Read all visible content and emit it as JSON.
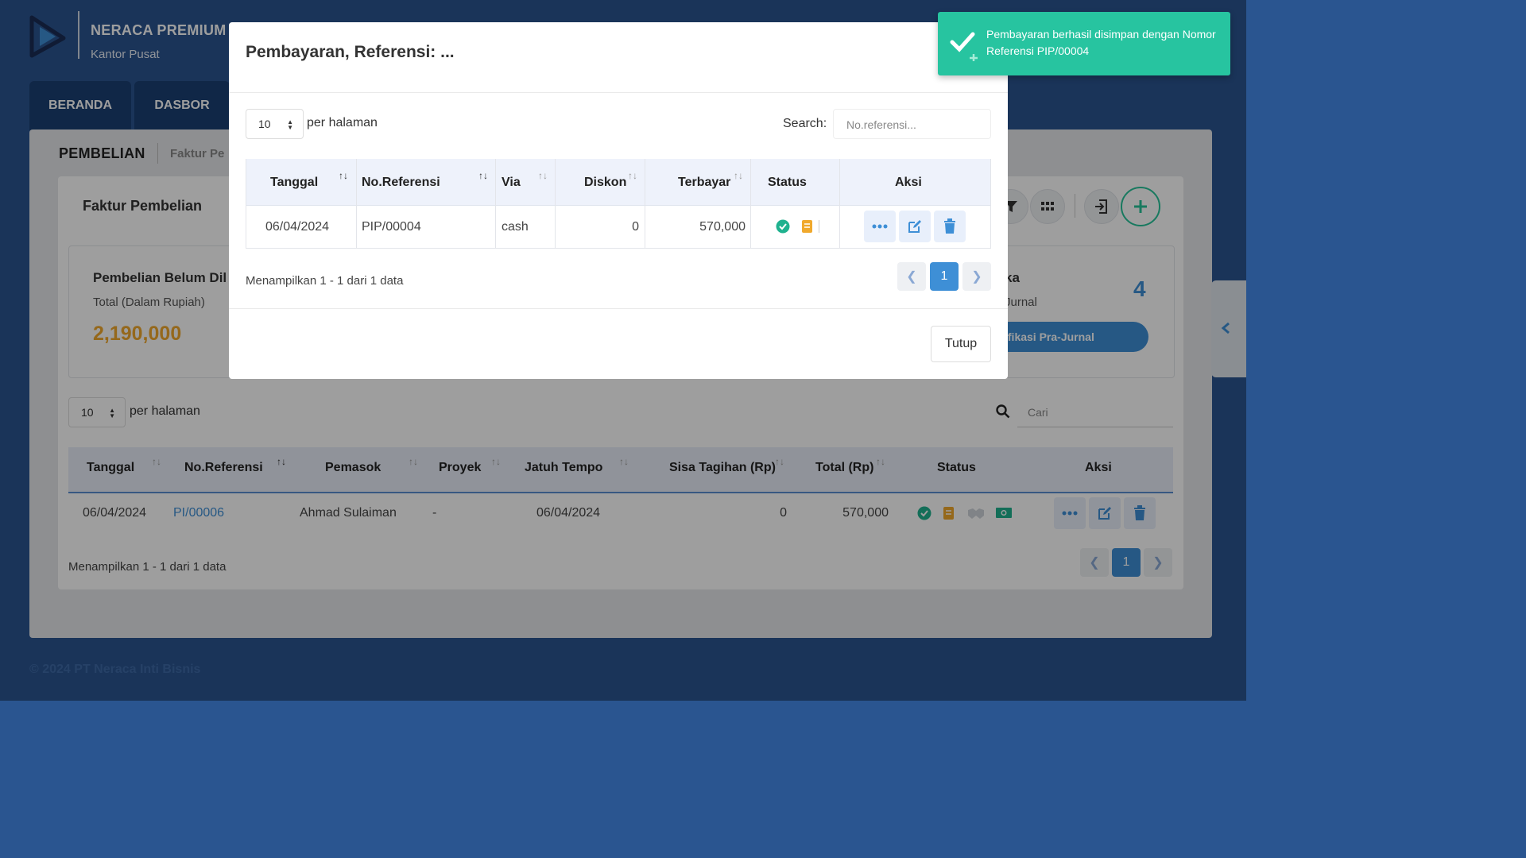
{
  "app": {
    "brand_name": "NERACA PREMIUM",
    "brand_sub": "Kantor Pusat",
    "nav_tabs": [
      "BERANDA",
      "DASBOR"
    ],
    "section_title": "PEMBELIAN",
    "breadcrumb": "Faktur Pe",
    "card_title": "Faktur Pembelian",
    "footer": "© 2024 PT Neraca Inti Bisnis"
  },
  "stats": {
    "left_title": "Pembelian Belum Dil",
    "left_sub": "Total (Dalam Rupiah)",
    "left_value": "2,190,000",
    "right_title": "ka",
    "right_sub": "Jurnal",
    "right_number": "4",
    "right_button": "ifikasi Pra-Jurnal"
  },
  "main_table": {
    "page_size": "10",
    "per_page_label": "per halaman",
    "search_placeholder": "Cari",
    "headers": [
      "Tanggal",
      "No.Referensi",
      "Pemasok",
      "Proyek",
      "Jatuh Tempo",
      "Sisa Tagihan (Rp)",
      "Total (Rp)",
      "Status",
      "Aksi"
    ],
    "rows": [
      {
        "tanggal": "06/04/2024",
        "referensi": "PI/00006",
        "pemasok": "Ahmad Sulaiman",
        "proyek": "-",
        "jatuh_tempo": "06/04/2024",
        "sisa": "0",
        "total": "570,000"
      }
    ],
    "info": "Menampilkan 1 - 1 dari 1 data",
    "current_page": "1"
  },
  "modal": {
    "title": "Pembayaran, Referensi: ...",
    "page_size": "10",
    "per_page_label": "per halaman",
    "search_label": "Search:",
    "search_placeholder": "No.referensi...",
    "headers": [
      "Tanggal",
      "No.Referensi",
      "Via",
      "Diskon",
      "Terbayar",
      "Status",
      "Aksi"
    ],
    "rows": [
      {
        "tanggal": "06/04/2024",
        "referensi": "PIP/00004",
        "via": "cash",
        "diskon": "0",
        "terbayar": "570,000"
      }
    ],
    "info": "Menampilkan 1 - 1 dari 1 data",
    "current_page": "1",
    "close_label": "Tutup"
  },
  "toast": {
    "message": "Pembayaran berhasil disimpan dengan Nomor Referensi PIP/00004"
  },
  "colors": {
    "background": "#2a5590",
    "accent_blue": "#3e8fd6",
    "toast_green": "#27c4a0",
    "stat_orange": "#f0a92d",
    "status_teal": "#1fb28f"
  }
}
